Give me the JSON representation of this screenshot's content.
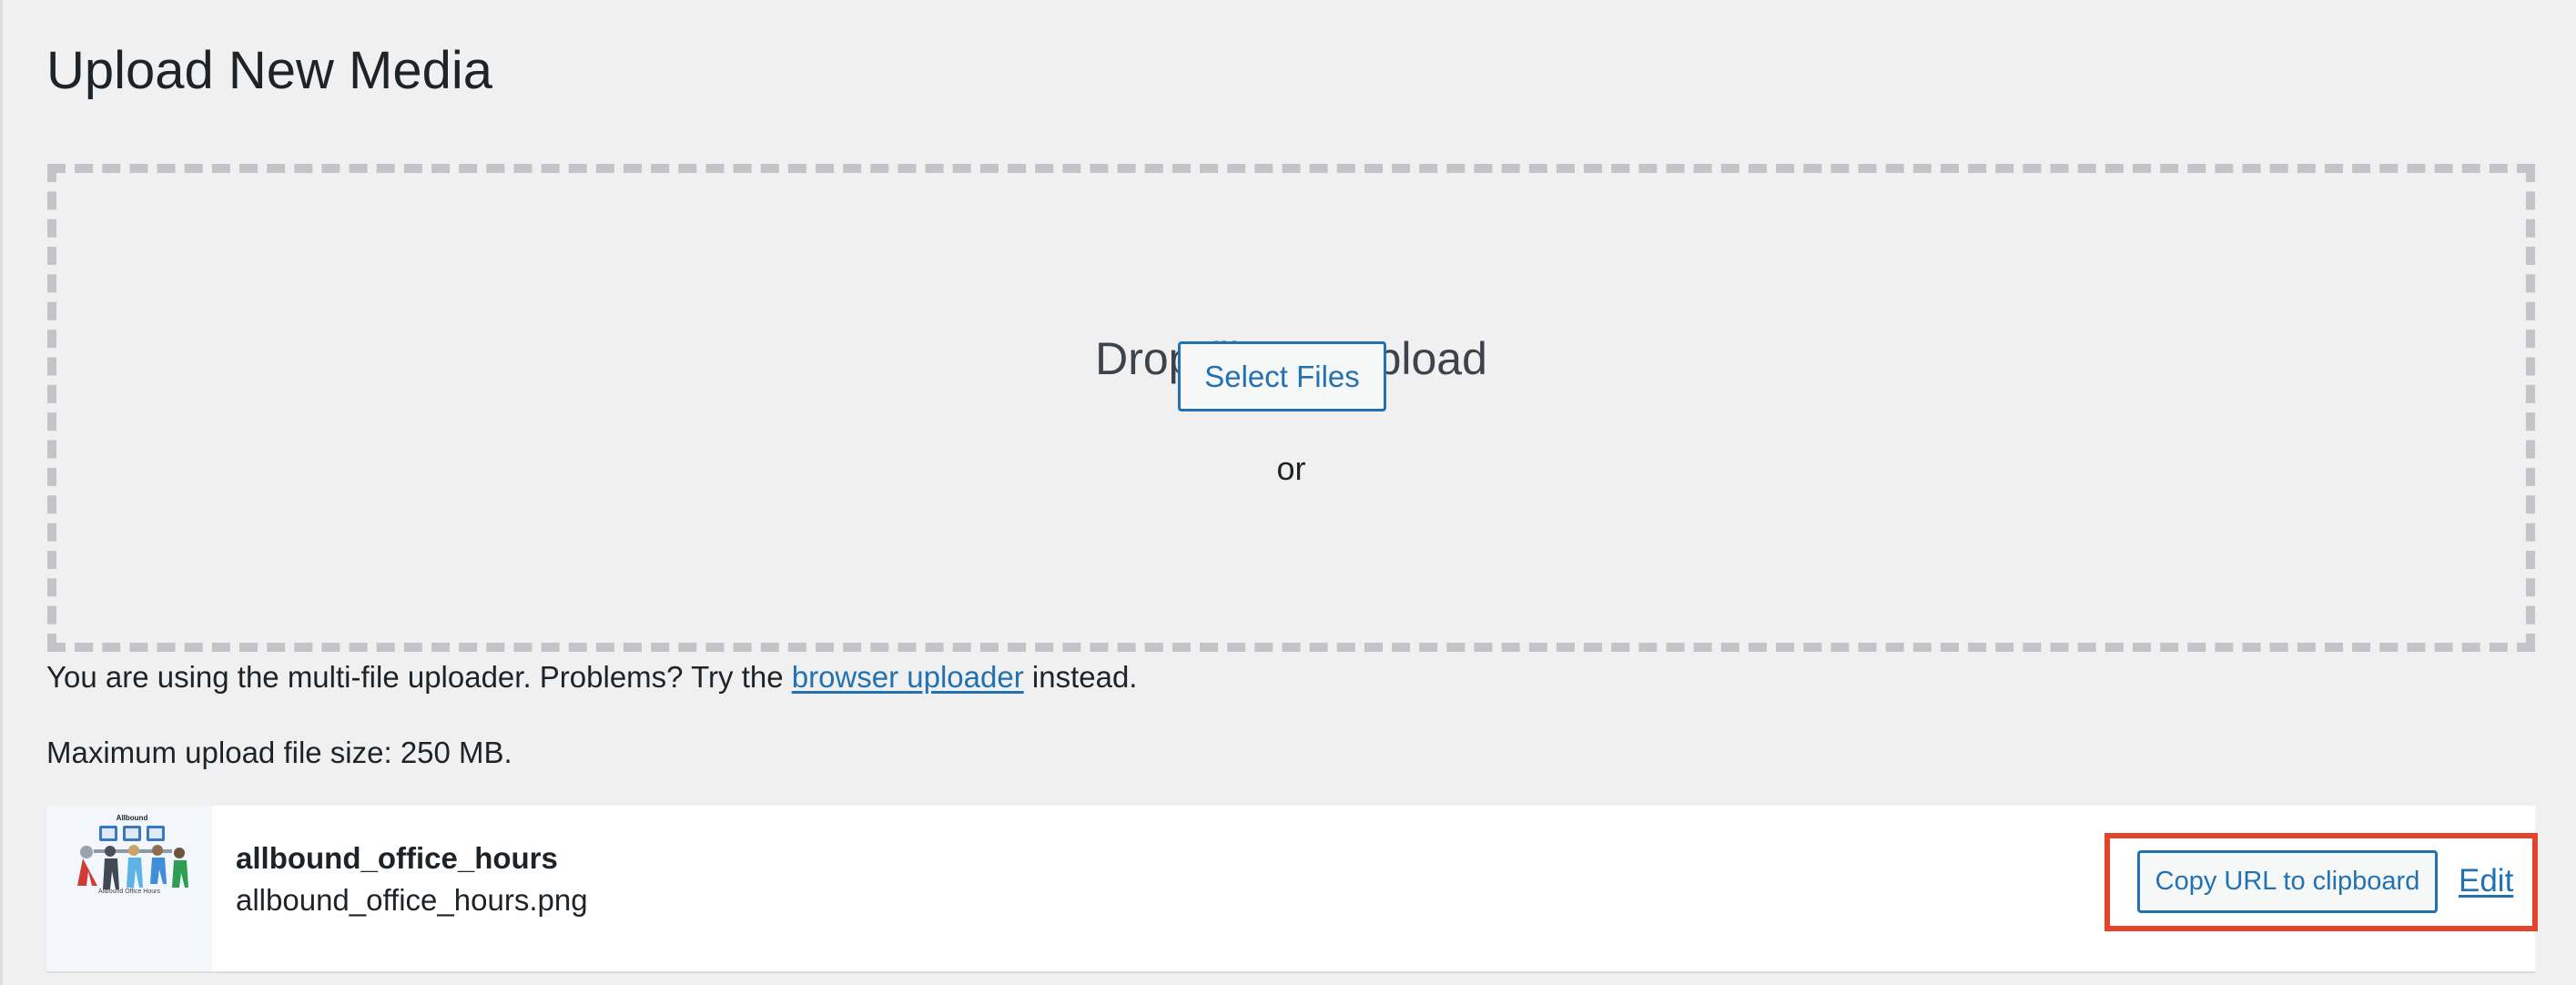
{
  "page": {
    "title": "Upload New Media"
  },
  "dropzone": {
    "title": "Drop files to upload",
    "or_text": "or",
    "select_button": "Select Files"
  },
  "uploader_note": {
    "before_link": "You are using the multi-file uploader. Problems? Try the ",
    "link_text": "browser uploader",
    "after_link": " instead."
  },
  "max_size": "Maximum upload file size: 250 MB.",
  "media_item": {
    "title": "allbound_office_hours",
    "filename": "allbound_office_hours.png",
    "thumbnail_icon": "image-thumbnail-icon",
    "thumbnail_caption": "Allbound Office Hours",
    "thumbnail_brand": "Allbound",
    "copy_button": "Copy URL to clipboard",
    "edit_link": "Edit"
  },
  "colors": {
    "accent": "#2271b1",
    "background": "#f0f0f1",
    "highlight": "#e5432b",
    "dashed_border": "#c3c4c7"
  }
}
